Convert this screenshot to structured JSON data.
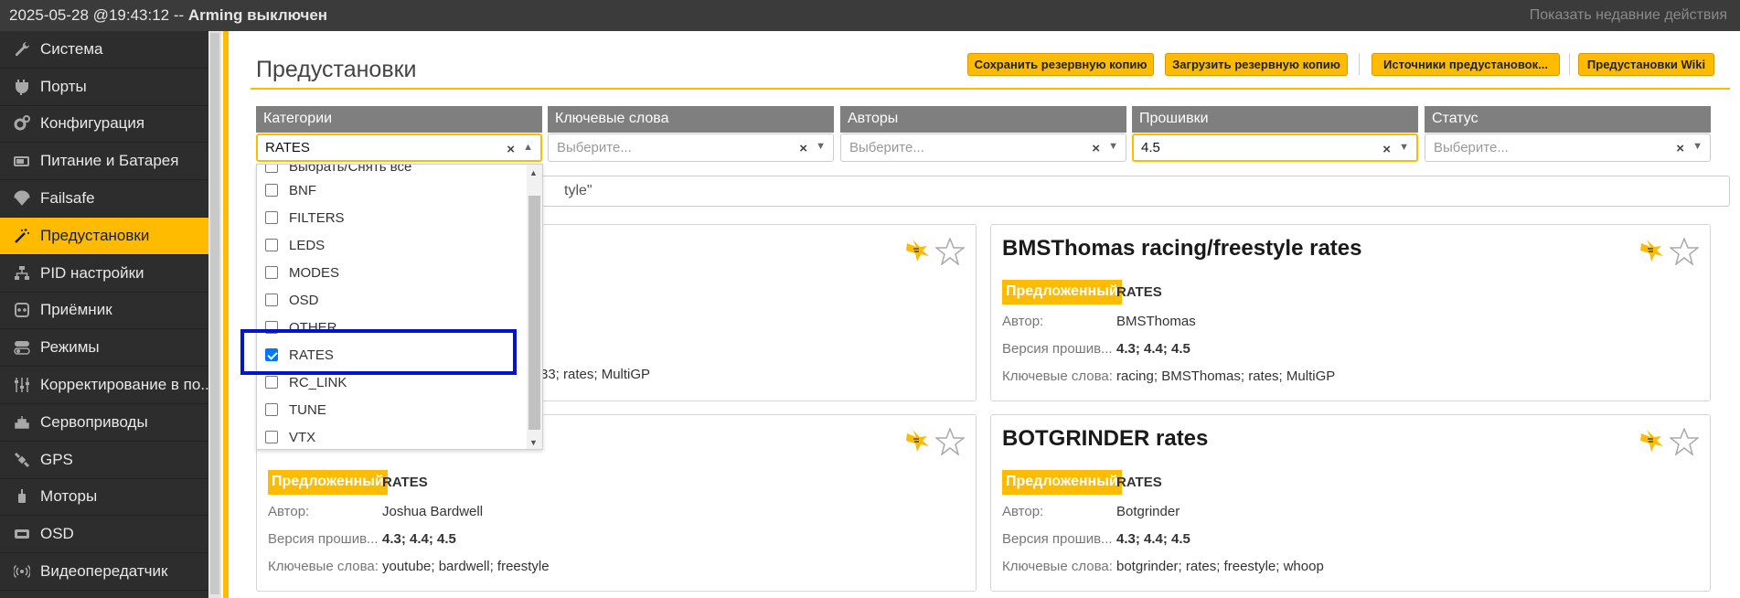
{
  "topbar": {
    "datetime": "2025-05-28 @19:43:12 --",
    "arming": "Arming выключен",
    "recent_actions": "Показать недавние действия"
  },
  "sidebar": {
    "items": [
      {
        "label": "Система",
        "icon": "wrench-icon"
      },
      {
        "label": "Порты",
        "icon": "plug-icon"
      },
      {
        "label": "Конфигурация",
        "icon": "gears-icon"
      },
      {
        "label": "Питание и Батарея",
        "icon": "battery-icon"
      },
      {
        "label": "Failsafe",
        "icon": "parachute-icon"
      },
      {
        "label": "Предустановки",
        "icon": "magic-wand-icon"
      },
      {
        "label": "PID настройки",
        "icon": "sitemap-icon"
      },
      {
        "label": "Приёмник",
        "icon": "gamepad-icon"
      },
      {
        "label": "Режимы",
        "icon": "toggle-icon"
      },
      {
        "label": "Корректирование в по...",
        "icon": "sliders-icon"
      },
      {
        "label": "Сервоприводы",
        "icon": "servo-icon"
      },
      {
        "label": "GPS",
        "icon": "satellite-icon"
      },
      {
        "label": "Моторы",
        "icon": "motor-icon"
      },
      {
        "label": "OSD",
        "icon": "osd-icon"
      },
      {
        "label": "Видеопередатчик",
        "icon": "broadcast-icon"
      }
    ],
    "active_index": 5
  },
  "page": {
    "title": "Предустановки",
    "buttons": {
      "save_backup": "Сохранить резервную копию",
      "load_backup": "Загрузить резервную копию",
      "sources": "Источники предустановок...",
      "wiki": "Предустановки Wiki"
    }
  },
  "filters": {
    "categories": {
      "header": "Категории",
      "value": "RATES"
    },
    "keywords": {
      "header": "Ключевые слова",
      "placeholder": "Выберите..."
    },
    "authors": {
      "header": "Авторы",
      "placeholder": "Выберите..."
    },
    "firmware": {
      "header": "Прошивки",
      "value": "4.5"
    },
    "status": {
      "header": "Статус",
      "placeholder": "Выберите..."
    }
  },
  "search": {
    "visible_text": "tyle\""
  },
  "dropdown": {
    "partial_first": "Выбрать/Снять все",
    "items": [
      {
        "label": "BNF",
        "checked": false
      },
      {
        "label": "FILTERS",
        "checked": false
      },
      {
        "label": "LEDS",
        "checked": false
      },
      {
        "label": "MODES",
        "checked": false
      },
      {
        "label": "OSD",
        "checked": false
      },
      {
        "label": "OTHER",
        "checked": false
      },
      {
        "label": "RATES",
        "checked": true
      },
      {
        "label": "RC_LINK",
        "checked": false
      },
      {
        "label": "TUNE",
        "checked": false
      },
      {
        "label": "VTX",
        "checked": false
      }
    ]
  },
  "labels": {
    "author": "Автор:",
    "firmware_version": "Версия прошив...",
    "keywords": "Ключевые слова:"
  },
  "cards": [
    {
      "title": "",
      "badge": "",
      "category": "",
      "author": "",
      "versions": "",
      "keywords": "33; rates; MultiGP"
    },
    {
      "title": "BMSThomas racing/freestyle rates",
      "badge": "Предложенный",
      "category": "RATES",
      "author": "BMSThomas",
      "versions": "4.3; 4.4; 4.5",
      "keywords": "racing; BMSThomas; rates; MultiGP"
    },
    {
      "title": "",
      "badge": "Предложенный",
      "category": "RATES",
      "author": "Joshua Bardwell",
      "versions": "4.3; 4.4; 4.5",
      "keywords": "youtube; bardwell; freestyle"
    },
    {
      "title": "BOTGRINDER rates",
      "badge": "Предложенный",
      "category": "RATES",
      "author": "Botgrinder",
      "versions": "4.3; 4.4; 4.5",
      "keywords": "botgrinder; rates; freestyle; whoop"
    }
  ]
}
